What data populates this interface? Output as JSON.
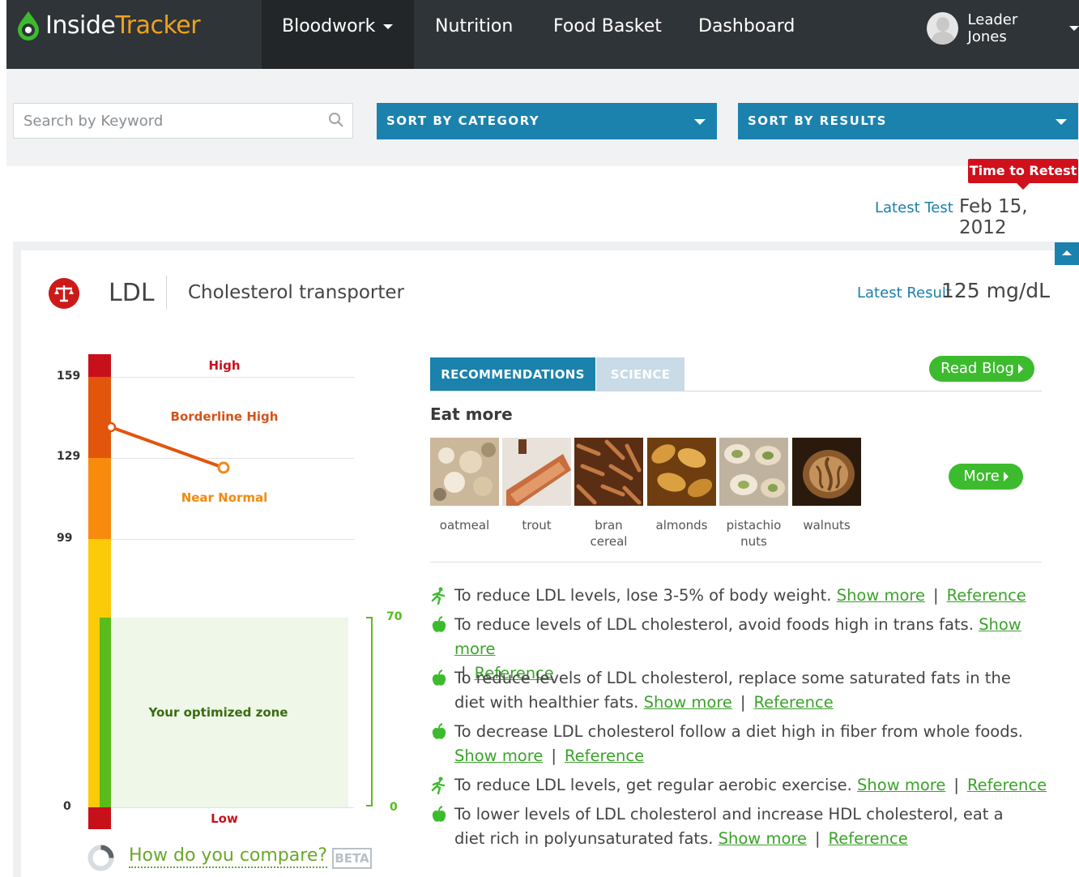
{
  "nav": {
    "logo_part1": "Inside",
    "logo_part2": "Tracker",
    "items": [
      "Bloodwork",
      "Nutrition",
      "Food Basket",
      "Dashboard"
    ],
    "user_name": "Leader Jones"
  },
  "filters": {
    "search_placeholder": "Search by Keyword",
    "sort_category": "SORT BY CATEGORY",
    "sort_results": "SORT BY RESULTS"
  },
  "retest_badge": "Time to Retest",
  "latest_test": {
    "label": "Latest Test",
    "date": "Feb 15, 2012"
  },
  "marker": {
    "name": "LDL",
    "description": "Cholesterol transporter",
    "latest_result_label": "Latest Result",
    "latest_result_value": "125 mg/dL"
  },
  "gauge": {
    "ticks": [
      "159",
      "129",
      "99",
      "0"
    ],
    "zones": {
      "high": "High",
      "borderline_high": "Borderline High",
      "near_normal": "Near Normal",
      "low": "Low"
    },
    "optimized_zone_label": "Your optimized zone",
    "optimized_upper": "70",
    "optimized_lower": "0",
    "colors": {
      "high": "#c8101b",
      "borderline": "#e2550d",
      "near_normal": "#f88b0e",
      "yellow": "#fbcb0a",
      "optimized": "#5bbb1c"
    }
  },
  "compare": {
    "link": "How do you compare?",
    "badge": "BETA"
  },
  "tabs": {
    "recommendations": "RECOMMENDATIONS",
    "science": "SCIENCE"
  },
  "buttons": {
    "read_blog": "Read Blog",
    "more": "More"
  },
  "eat_more": {
    "title": "Eat more",
    "foods": [
      "oatmeal",
      "trout",
      "bran cereal",
      "almonds",
      "pistachio nuts",
      "walnuts"
    ]
  },
  "recommendations": [
    {
      "icon": "exercise-icon",
      "text": "To reduce LDL levels, lose 3-5% of body weight.",
      "show_more": "Show more",
      "reference": "Reference"
    },
    {
      "icon": "apple-icon",
      "text": "To reduce levels of LDL cholesterol, avoid foods high in trans fats.",
      "show_more": "Show more",
      "reference": "Reference"
    },
    {
      "icon": "apple-icon",
      "text": "To reduce levels of LDL cholesterol, replace some saturated fats in the diet with healthier fats.",
      "show_more": "Show more",
      "reference": "Reference"
    },
    {
      "icon": "apple-icon",
      "text": "To decrease LDL cholesterol follow a diet high in fiber from whole foods.",
      "show_more": "Show more",
      "reference": "Reference"
    },
    {
      "icon": "exercise-icon",
      "text": "To reduce LDL levels, get regular aerobic exercise.",
      "show_more": "Show more",
      "reference": "Reference"
    },
    {
      "icon": "apple-icon",
      "text": "To lower levels of LDL cholesterol and increase HDL cholesterol, eat a diet rich in polyunsaturated fats.",
      "show_more": "Show more",
      "reference": "Reference"
    }
  ]
}
